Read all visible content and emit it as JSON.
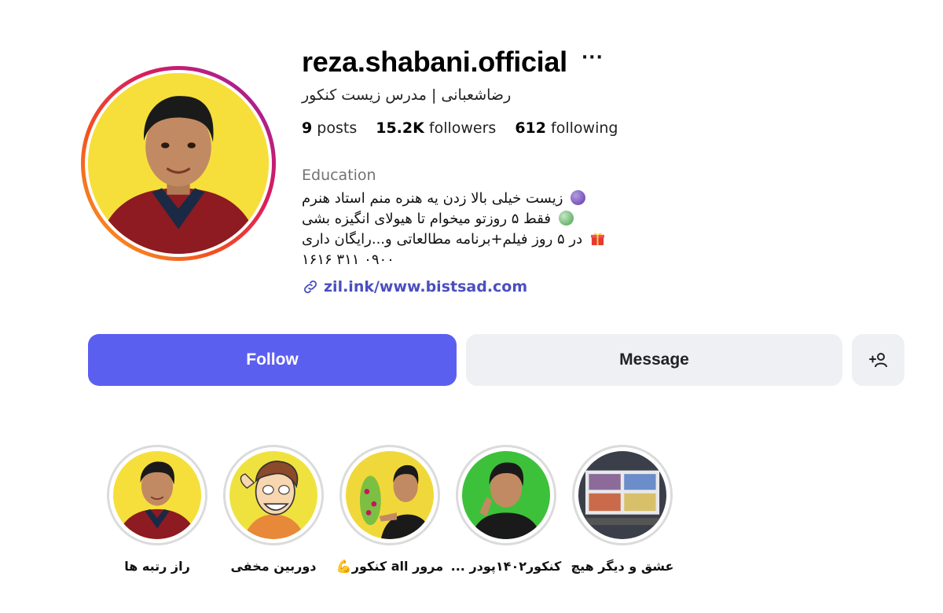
{
  "profile": {
    "username": "reza.shabani.official",
    "more_icon": "more-horizontal-icon",
    "full_name": "رضاشعبانی | مدرس زیست کنکور",
    "stats": {
      "posts_count": "9",
      "posts_label": "posts",
      "followers_count": "15.2K",
      "followers_label": "followers",
      "following_count": "612",
      "following_label": "following"
    },
    "category": "Education",
    "bio": {
      "line1": "زیست خیلی بالا زدن یه هنره منم استاد هنرم",
      "line2": "فقط ۵ روزتو میخوام تا هیولای انگیزه بشی",
      "line3": "در ۵ روز فیلم+برنامه مطالعاتی و...رایگان داری",
      "line4": "۰۹۰۰ ۳۱۱ ۱۶۱۶"
    },
    "link": "zil.ink/www.bistsad.com"
  },
  "actions": {
    "follow_label": "Follow",
    "message_label": "Message",
    "add_icon": "add-person-icon"
  },
  "highlights": [
    {
      "label": "عشق و دیگر هیچ"
    },
    {
      "label": "کنکور۱۴۰۲پودر ..."
    },
    {
      "label": "مرور all کنکور💪"
    },
    {
      "label": "دوربین مخفی"
    },
    {
      "label": "راز رتبه ها"
    }
  ],
  "colors": {
    "follow_button": "#5b5ff0",
    "secondary_button": "#eef0f4",
    "link": "#4a4fbf",
    "avatar_background": "#f6df3b"
  }
}
